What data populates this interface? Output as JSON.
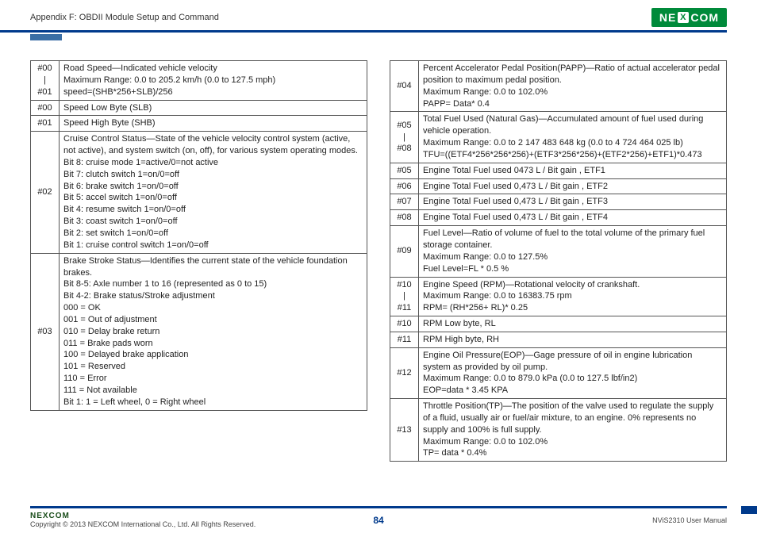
{
  "header": {
    "title": "Appendix F: OBDII Module Setup and Command",
    "logo_text_pre": "NE",
    "logo_x": "X",
    "logo_text_post": "COM"
  },
  "left_table": [
    {
      "id": "#00\n|\n#01",
      "desc": "Road Speed—Indicated vehicle velocity\nMaximum Range: 0.0 to 205.2 km/h (0.0 to 127.5 mph)\nspeed=(SHB*256+SLB)/256"
    },
    {
      "id": "#00",
      "desc": "Speed Low Byte (SLB)"
    },
    {
      "id": "#01",
      "desc": "Speed High Byte (SHB)"
    },
    {
      "id": "#02",
      "desc": "Cruise Control Status—State of the vehicle velocity control system (active, not active), and system switch (on, off), for various system operating modes.\nBit 8: cruise mode 1=active/0=not active\nBit 7: clutch switch 1=on/0=off\nBit 6: brake switch 1=on/0=off\nBit 5: accel switch 1=on/0=off\nBit 4: resume switch 1=on/0=off\nBit 3: coast switch 1=on/0=off\nBit 2: set switch 1=on/0=off\nBit 1: cruise control switch 1=on/0=off"
    },
    {
      "id": "#03",
      "desc": "Brake Stroke Status—Identifies the current state of the vehicle foundation brakes.\nBit 8-5: Axle number 1 to 16 (represented as 0 to 15)\nBit 4-2: Brake status/Stroke adjustment\n000 = OK\n001 = Out of adjustment\n010 = Delay brake return\n011 = Brake pads worn\n100 = Delayed brake application\n101 = Reserved\n110 = Error\n111 = Not available\nBit 1: 1 = Left wheel, 0 = Right wheel"
    }
  ],
  "right_table": [
    {
      "id": "#04",
      "desc": "Percent Accelerator Pedal Position(PAPP)—Ratio of actual accelerator pedal position to maximum pedal position.\nMaximum Range: 0.0 to 102.0%\nPAPP= Data* 0.4"
    },
    {
      "id": "#05\n|\n#08",
      "desc": "Total Fuel Used (Natural Gas)—Accumulated amount of fuel used during vehicle operation.\nMaximum Range: 0.0 to 2 147 483 648 kg (0.0 to 4 724 464 025 lb)\nTFU=((ETF4*256*256*256)+(ETF3*256*256)+(ETF2*256)+ETF1)*0.473"
    },
    {
      "id": "#05",
      "desc": "Engine Total Fuel used 0473 L / Bit gain , ETF1"
    },
    {
      "id": "#06",
      "desc": "Engine Total Fuel used 0,473 L / Bit gain , ETF2"
    },
    {
      "id": "#07",
      "desc": "Engine Total Fuel used 0,473 L / Bit gain , ETF3"
    },
    {
      "id": "#08",
      "desc": "Engine Total Fuel used 0,473 L / Bit gain , ETF4"
    },
    {
      "id": "#09",
      "desc": "Fuel Level—Ratio of volume of fuel to the total volume of the primary fuel storage container.\nMaximum Range: 0.0 to 127.5%\nFuel Level=FL * 0.5 %"
    },
    {
      "id": "#10\n|\n#11",
      "desc": "Engine Speed (RPM)—Rotational velocity of crankshaft.\nMaximum Range: 0.0 to 16383.75 rpm\nRPM= (RH*256+ RL)* 0.25"
    },
    {
      "id": "#10",
      "desc": "RPM Low byte, RL"
    },
    {
      "id": "#11",
      "desc": "RPM High byte, RH"
    },
    {
      "id": "#12",
      "desc": "Engine Oil Pressure(EOP)—Gage pressure of oil in engine lubrication system as provided by oil pump.\nMaximum Range: 0.0 to 879.0 kPa (0.0 to 127.5 lbf/in2)\nEOP=data * 3.45 KPA"
    },
    {
      "id": "#13",
      "desc": "Throttle Position(TP)—The position of the valve used to regulate the supply of a fluid, usually air or fuel/air mixture, to an engine. 0% represents no supply and 100% is full supply.\nMaximum Range: 0.0 to 102.0%\nTP= data * 0.4%"
    }
  ],
  "footer": {
    "logo": "NEXCOM",
    "copyright": "Copyright © 2013 NEXCOM International Co., Ltd. All Rights Reserved.",
    "page": "84",
    "manual": "NViS2310 User Manual"
  }
}
